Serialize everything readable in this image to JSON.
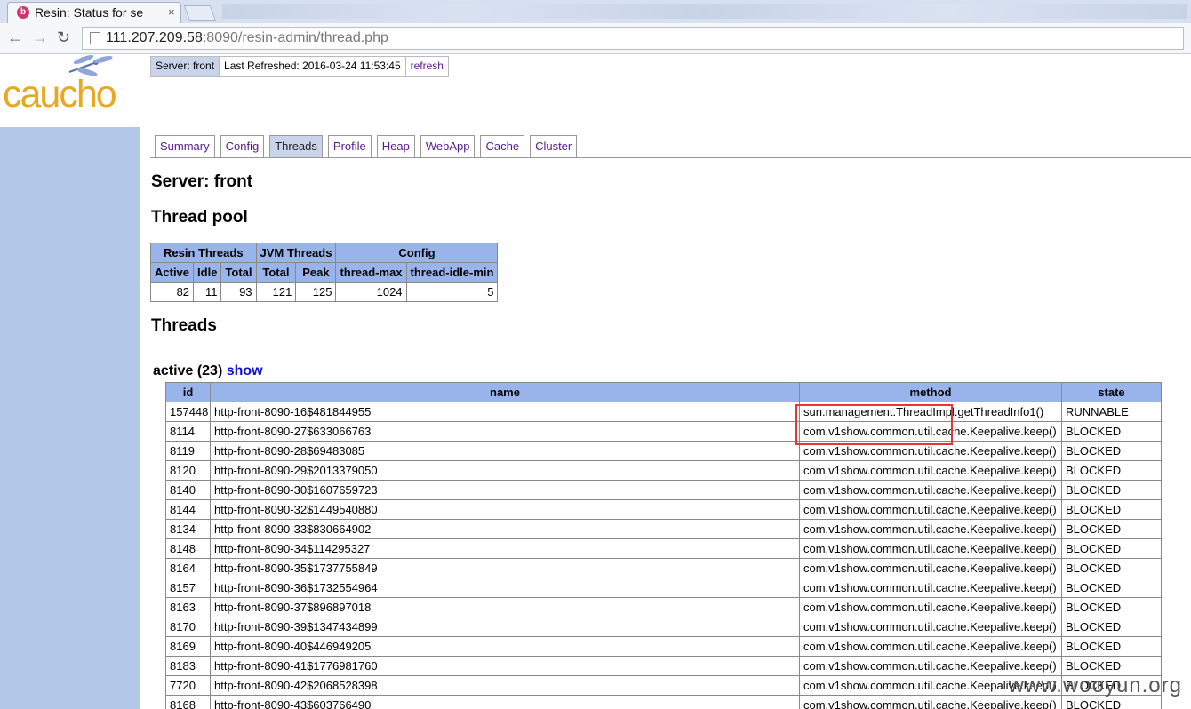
{
  "browser": {
    "tab_title": "Resin: Status for se",
    "tab_close": "×",
    "url_host": "111.207.209.58",
    "url_rest": ":8090/resin-admin/thread.php"
  },
  "logo": "caucho",
  "server_bar": {
    "server": "Server: front",
    "refreshed": "Last Refreshed: 2016-03-24 11:53:45",
    "refresh_link": "refresh"
  },
  "tabs": [
    "Summary",
    "Config",
    "Threads",
    "Profile",
    "Heap",
    "WebApp",
    "Cache",
    "Cluster"
  ],
  "active_tab": "Threads",
  "headings": {
    "server": "Server: front",
    "pool": "Thread pool",
    "threads": "Threads"
  },
  "pool_table": {
    "groups": [
      {
        "label": "Resin Threads",
        "span": 3
      },
      {
        "label": "JVM Threads",
        "span": 2
      },
      {
        "label": "Config",
        "span": 2
      }
    ],
    "columns": [
      "Active",
      "Idle",
      "Total",
      "Total",
      "Peak",
      "thread-max",
      "thread-idle-min"
    ],
    "values": [
      "82",
      "11",
      "93",
      "121",
      "125",
      "1024",
      "5"
    ]
  },
  "active_section": {
    "label": "active (23)",
    "show_link": "show"
  },
  "threads_table": {
    "columns": [
      "id",
      "name",
      "method",
      "state"
    ],
    "rows": [
      [
        "157448",
        "http-front-8090-16$481844955",
        "sun.management.ThreadImpl.getThreadInfo1()",
        "RUNNABLE"
      ],
      [
        "8114",
        "http-front-8090-27$633066763",
        "com.v1show.common.util.cache.Keepalive.keep()",
        "BLOCKED"
      ],
      [
        "8119",
        "http-front-8090-28$69483085",
        "com.v1show.common.util.cache.Keepalive.keep()",
        "BLOCKED"
      ],
      [
        "8120",
        "http-front-8090-29$2013379050",
        "com.v1show.common.util.cache.Keepalive.keep()",
        "BLOCKED"
      ],
      [
        "8140",
        "http-front-8090-30$1607659723",
        "com.v1show.common.util.cache.Keepalive.keep()",
        "BLOCKED"
      ],
      [
        "8144",
        "http-front-8090-32$1449540880",
        "com.v1show.common.util.cache.Keepalive.keep()",
        "BLOCKED"
      ],
      [
        "8134",
        "http-front-8090-33$830664902",
        "com.v1show.common.util.cache.Keepalive.keep()",
        "BLOCKED"
      ],
      [
        "8148",
        "http-front-8090-34$114295327",
        "com.v1show.common.util.cache.Keepalive.keep()",
        "BLOCKED"
      ],
      [
        "8164",
        "http-front-8090-35$1737755849",
        "com.v1show.common.util.cache.Keepalive.keep()",
        "BLOCKED"
      ],
      [
        "8157",
        "http-front-8090-36$1732554964",
        "com.v1show.common.util.cache.Keepalive.keep()",
        "BLOCKED"
      ],
      [
        "8163",
        "http-front-8090-37$896897018",
        "com.v1show.common.util.cache.Keepalive.keep()",
        "BLOCKED"
      ],
      [
        "8170",
        "http-front-8090-39$1347434899",
        "com.v1show.common.util.cache.Keepalive.keep()",
        "BLOCKED"
      ],
      [
        "8169",
        "http-front-8090-40$446949205",
        "com.v1show.common.util.cache.Keepalive.keep()",
        "BLOCKED"
      ],
      [
        "8183",
        "http-front-8090-41$1776981760",
        "com.v1show.common.util.cache.Keepalive.keep()",
        "BLOCKED"
      ],
      [
        "7720",
        "http-front-8090-42$2068528398",
        "com.v1show.common.util.cache.Keepalive.keep()",
        "BLOCKED"
      ],
      [
        "8168",
        "http-front-8090-43$603766490",
        "com.v1show.common.util.cache.Keepalive.keep()",
        "BLOCKED"
      ]
    ]
  },
  "watermark": "www.wooyun.org",
  "colors": {
    "sidebar": "#b3c7e6",
    "header_cell": "#98b4ea",
    "logo": "#e8a822",
    "highlight": "#e53535"
  }
}
